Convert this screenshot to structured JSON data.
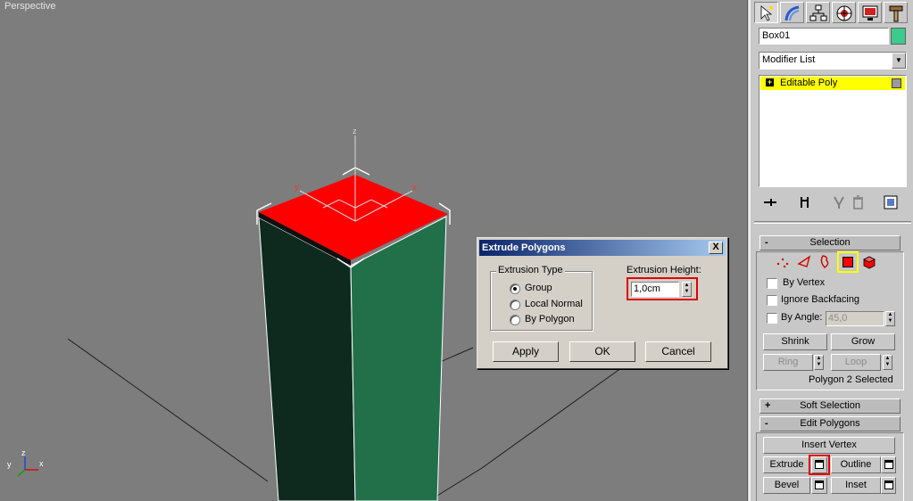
{
  "viewport": {
    "label": "Perspective",
    "axis_labels": {
      "gizmo_x": "x",
      "gizmo_y": "y",
      "gizmo_z": "z"
    },
    "mini_axes": {
      "x": "x",
      "y": "y",
      "z": "z"
    }
  },
  "colors": {
    "selected_face": "#ff0000",
    "front_face": "#0e2a1f",
    "side_face": "#22704a",
    "viewport_bg": "#7d7d7d",
    "object_color_swatch": "#3ccb8c",
    "highlight_yellow": "#ffff00",
    "callout_red": "#e00000"
  },
  "command_panel": {
    "tabs": [
      {
        "name": "create",
        "icon": "pointer-star-icon",
        "active": true
      },
      {
        "name": "modify",
        "icon": "modify-arc-icon",
        "active": false
      },
      {
        "name": "hierarchy",
        "icon": "hierarchy-icon",
        "active": false
      },
      {
        "name": "motion",
        "icon": "motion-wheel-icon",
        "active": false
      },
      {
        "name": "display",
        "icon": "display-monitor-icon",
        "active": false
      },
      {
        "name": "utilities",
        "icon": "hammer-icon",
        "active": false
      }
    ],
    "object_name": "Box01",
    "modifier_list": "Modifier List",
    "stack": [
      {
        "label": "Editable Poly",
        "expand": "+"
      }
    ],
    "selection": {
      "header": "Selection",
      "header_pm": "-",
      "by_vertex": "By Vertex",
      "ignore_backfacing": "Ignore Backfacing",
      "by_angle": "By Angle:",
      "by_angle_value": "45,0",
      "shrink": "Shrink",
      "grow": "Grow",
      "ring": "Ring",
      "loop": "Loop",
      "status": "Polygon 2 Selected"
    },
    "soft_selection": {
      "header": "Soft Selection",
      "header_pm": "+"
    },
    "edit_polygons": {
      "header": "Edit Polygons",
      "header_pm": "-",
      "insert_vertex": "Insert Vertex",
      "extrude": "Extrude",
      "outline": "Outline",
      "bevel": "Bevel",
      "inset": "Inset"
    }
  },
  "dialog": {
    "title": "Extrude Polygons",
    "close": "X",
    "extrusion_type": {
      "label": "Extrusion Type",
      "options": [
        "Group",
        "Local Normal",
        "By Polygon"
      ],
      "selected": "Group"
    },
    "extrusion_height": {
      "label": "Extrusion Height:",
      "value": "1,0cm"
    },
    "buttons": {
      "apply": "Apply",
      "ok": "OK",
      "cancel": "Cancel"
    }
  }
}
